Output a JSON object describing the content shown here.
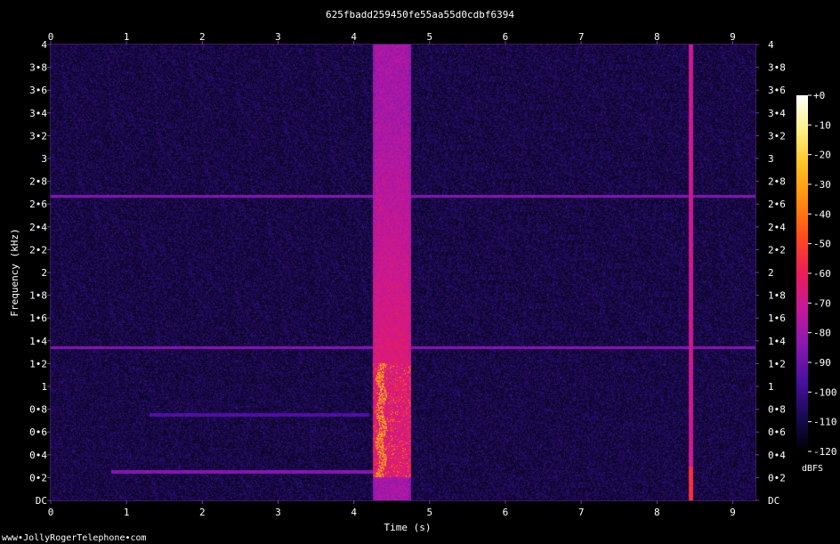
{
  "chart_data": {
    "type": "heatmap",
    "title": "625fbadd259450fe55aa55d0cdbf6394",
    "xlabel": "Time (s)",
    "ylabel": "Frequency (kHz)",
    "watermark": "www•JollyRogerTelephone•com",
    "x_ticks": [
      "0",
      "1",
      "2",
      "3",
      "4",
      "5",
      "6",
      "7",
      "8",
      "9"
    ],
    "x_tick_values": [
      0,
      1,
      2,
      3,
      4,
      5,
      6,
      7,
      8,
      9
    ],
    "xlim": [
      0,
      9.3
    ],
    "y_ticks": [
      "DC",
      "0•2",
      "0•4",
      "0•6",
      "0•8",
      "1",
      "1•2",
      "1•4",
      "1•6",
      "1•8",
      "2",
      "2•2",
      "2•4",
      "2•6",
      "2•8",
      "3",
      "3•2",
      "3•4",
      "3•6",
      "3•8",
      "4"
    ],
    "y_tick_values": [
      0,
      0.2,
      0.4,
      0.6,
      0.8,
      1.0,
      1.2,
      1.4,
      1.6,
      1.8,
      2.0,
      2.2,
      2.4,
      2.6,
      2.8,
      3.0,
      3.2,
      3.4,
      3.6,
      3.8,
      4.0
    ],
    "ylim": [
      0,
      4
    ],
    "colorbar": {
      "label": "dBFS",
      "tick_labels": [
        "+0",
        "-10",
        "-20",
        "-30",
        "-40",
        "-50",
        "-60",
        "-70",
        "-80",
        "-90",
        "-100",
        "-110",
        "-120"
      ],
      "tick_values": [
        0,
        -10,
        -20,
        -30,
        -40,
        -50,
        -60,
        -70,
        -80,
        -90,
        -100,
        -110,
        -120
      ],
      "range": [
        -120,
        0
      ],
      "colormap": [
        "#000000",
        "#1a0a55",
        "#4a10a0",
        "#8a18b0",
        "#c4189a",
        "#ec1c5a",
        "#ff4a1c",
        "#ff8a10",
        "#ffc020",
        "#fff080",
        "#ffffff"
      ]
    },
    "background_level_dbfs": -110,
    "features": [
      {
        "kind": "broadband-burst",
        "t_start": 4.25,
        "t_end": 4.75,
        "f_max_khz": 4.0,
        "peak_dbfs": -30,
        "strongest_band_khz": [
          0.2,
          1.2
        ]
      },
      {
        "kind": "vertical-click",
        "t": 8.45,
        "f_max_khz": 4.0,
        "peak_dbfs": -70
      },
      {
        "kind": "horizontal-tone",
        "f_khz": 2.67,
        "t_start": 0,
        "t_end": 9.3,
        "level_dbfs": -85
      },
      {
        "kind": "horizontal-tone",
        "f_khz": 1.34,
        "t_start": 0,
        "t_end": 9.3,
        "level_dbfs": -85
      },
      {
        "kind": "low-tone",
        "f_khz": 0.25,
        "t_start": 0.8,
        "t_end": 4.25,
        "level_dbfs": -85
      },
      {
        "kind": "low-tone",
        "f_khz": 0.75,
        "t_start": 1.3,
        "t_end": 4.2,
        "level_dbfs": -95
      }
    ]
  }
}
